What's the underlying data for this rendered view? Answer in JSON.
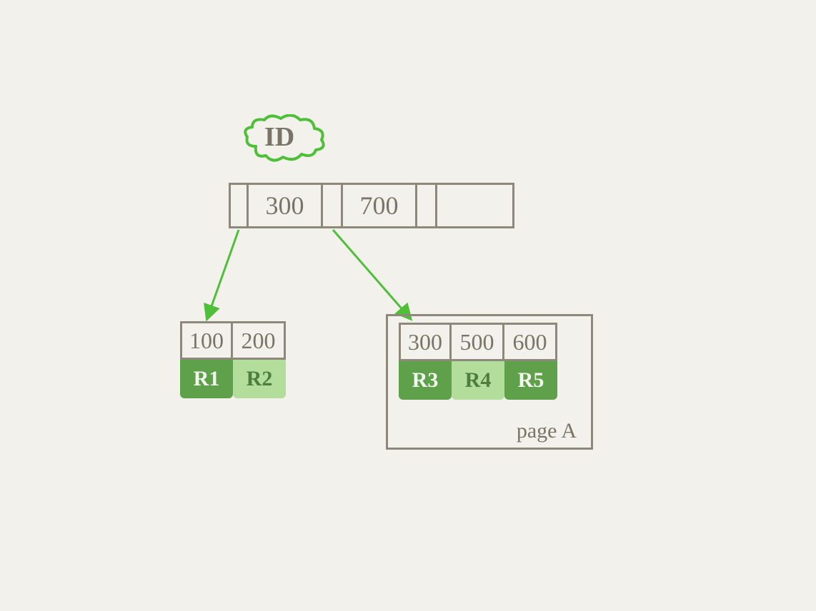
{
  "cloud_label": "ID",
  "root_keys": [
    "300",
    "700"
  ],
  "leaf1": {
    "keys": [
      "100",
      "200"
    ],
    "records": [
      "R1",
      "R2"
    ]
  },
  "leaf2": {
    "keys": [
      "300",
      "500",
      "600"
    ],
    "records": [
      "R3",
      "R4",
      "R5"
    ]
  },
  "page_label": "page A",
  "colors": {
    "stroke": "#8d877c",
    "arrow": "#4fbf3a",
    "dark_record": "#5fa04a",
    "light_record": "#b2dd9a"
  }
}
